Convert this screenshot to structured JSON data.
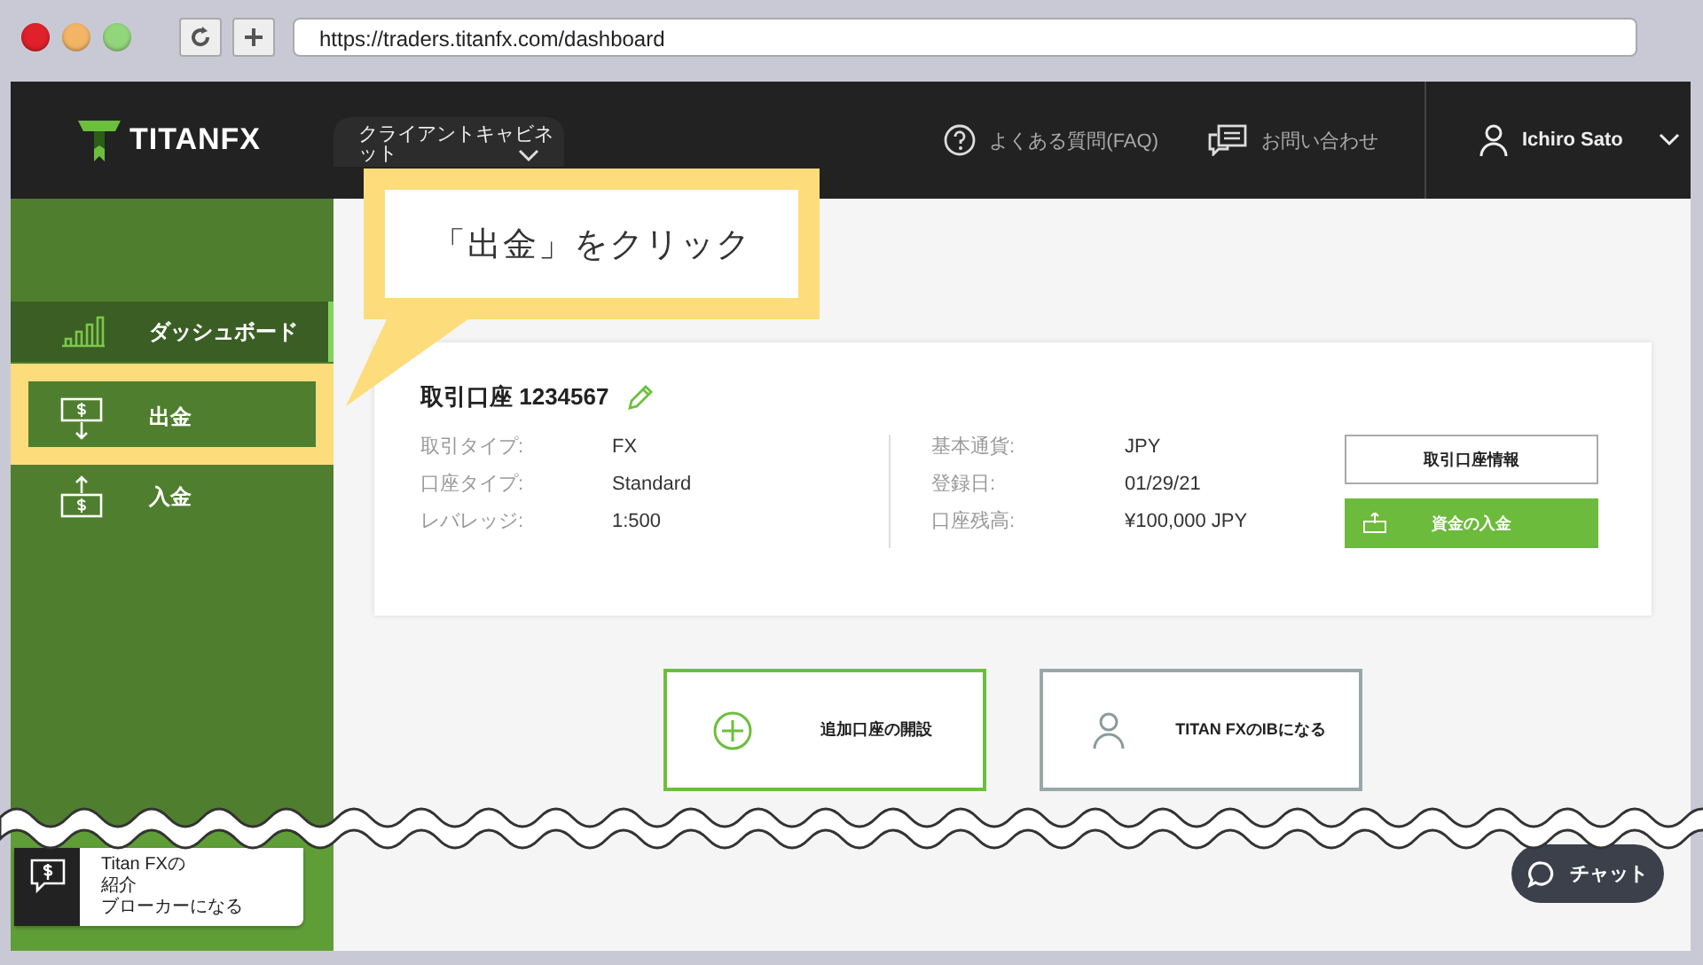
{
  "browser": {
    "url": "https://traders.titanfx.com/dashboard"
  },
  "header": {
    "logo": "TITANFX",
    "cabinet_menu": "クライアントキャビネット",
    "links": [
      {
        "label": "よくある質問(FAQ)",
        "kind": "faq"
      },
      {
        "label": "お問い合わせ",
        "kind": "contact"
      }
    ],
    "user": "Ichiro Sato"
  },
  "sidebar": {
    "items": [
      {
        "label": "ダッシュボード",
        "kind": "chart",
        "selected": true
      },
      {
        "label": "出金",
        "kind": "withdraw",
        "selected": false
      },
      {
        "label": "入金",
        "kind": "deposit",
        "selected": false
      }
    ]
  },
  "callout": {
    "text": "「出金」をクリック"
  },
  "account": {
    "title": "取引口座 1234567",
    "left": [
      {
        "label": "取引タイプ:",
        "value": "FX"
      },
      {
        "label": "口座タイプ:",
        "value": "Standard"
      },
      {
        "label": "レバレッジ:",
        "value": "1:500"
      }
    ],
    "right": [
      {
        "label": "基本通貨:",
        "value": "JPY"
      },
      {
        "label": "登録日:",
        "value": "01/29/21"
      },
      {
        "label": "口座残高:",
        "value": "¥100,000 JPY"
      }
    ],
    "buttons": [
      {
        "label": "取引口座情報",
        "kind": "outline"
      },
      {
        "label": "資金の入金",
        "kind": "primary"
      }
    ]
  },
  "actions": [
    {
      "label": "追加口座の開設",
      "kind": "add"
    },
    {
      "label": "TITAN FXのIBになる",
      "kind": "ib"
    }
  ],
  "promo": {
    "lines": [
      "Titan FXの",
      "紹介",
      "ブローカーになる"
    ]
  },
  "chat": {
    "label": "チャット"
  }
}
